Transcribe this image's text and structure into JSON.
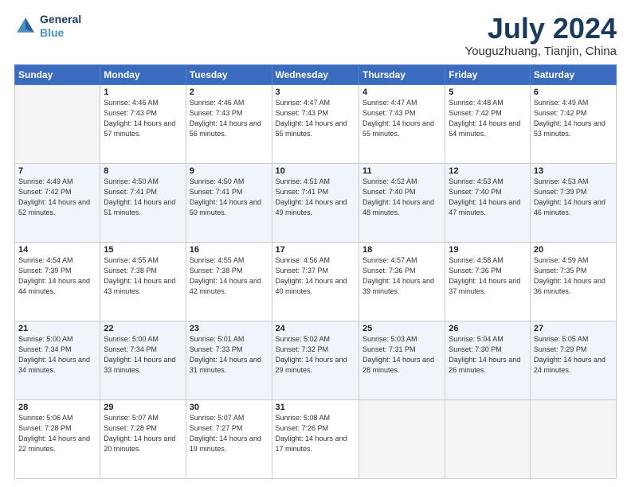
{
  "header": {
    "logo_line1": "General",
    "logo_line2": "Blue",
    "title": "July 2024",
    "subtitle": "Youguzhuang, Tianjin, China"
  },
  "weekdays": [
    "Sunday",
    "Monday",
    "Tuesday",
    "Wednesday",
    "Thursday",
    "Friday",
    "Saturday"
  ],
  "weeks": [
    [
      {
        "day": "",
        "empty": true
      },
      {
        "day": "1",
        "sunrise": "4:46 AM",
        "sunset": "7:43 PM",
        "daylight": "14 hours and 57 minutes."
      },
      {
        "day": "2",
        "sunrise": "4:46 AM",
        "sunset": "7:43 PM",
        "daylight": "14 hours and 56 minutes."
      },
      {
        "day": "3",
        "sunrise": "4:47 AM",
        "sunset": "7:43 PM",
        "daylight": "14 hours and 55 minutes."
      },
      {
        "day": "4",
        "sunrise": "4:47 AM",
        "sunset": "7:43 PM",
        "daylight": "14 hours and 55 minutes."
      },
      {
        "day": "5",
        "sunrise": "4:48 AM",
        "sunset": "7:42 PM",
        "daylight": "14 hours and 54 minutes."
      },
      {
        "day": "6",
        "sunrise": "4:49 AM",
        "sunset": "7:42 PM",
        "daylight": "14 hours and 53 minutes."
      }
    ],
    [
      {
        "day": "7",
        "sunrise": "4:49 AM",
        "sunset": "7:42 PM",
        "daylight": "14 hours and 52 minutes."
      },
      {
        "day": "8",
        "sunrise": "4:50 AM",
        "sunset": "7:41 PM",
        "daylight": "14 hours and 51 minutes."
      },
      {
        "day": "9",
        "sunrise": "4:50 AM",
        "sunset": "7:41 PM",
        "daylight": "14 hours and 50 minutes."
      },
      {
        "day": "10",
        "sunrise": "4:51 AM",
        "sunset": "7:41 PM",
        "daylight": "14 hours and 49 minutes."
      },
      {
        "day": "11",
        "sunrise": "4:52 AM",
        "sunset": "7:40 PM",
        "daylight": "14 hours and 48 minutes."
      },
      {
        "day": "12",
        "sunrise": "4:53 AM",
        "sunset": "7:40 PM",
        "daylight": "14 hours and 47 minutes."
      },
      {
        "day": "13",
        "sunrise": "4:53 AM",
        "sunset": "7:39 PM",
        "daylight": "14 hours and 46 minutes."
      }
    ],
    [
      {
        "day": "14",
        "sunrise": "4:54 AM",
        "sunset": "7:39 PM",
        "daylight": "14 hours and 44 minutes."
      },
      {
        "day": "15",
        "sunrise": "4:55 AM",
        "sunset": "7:38 PM",
        "daylight": "14 hours and 43 minutes."
      },
      {
        "day": "16",
        "sunrise": "4:55 AM",
        "sunset": "7:38 PM",
        "daylight": "14 hours and 42 minutes."
      },
      {
        "day": "17",
        "sunrise": "4:56 AM",
        "sunset": "7:37 PM",
        "daylight": "14 hours and 40 minutes."
      },
      {
        "day": "18",
        "sunrise": "4:57 AM",
        "sunset": "7:36 PM",
        "daylight": "14 hours and 39 minutes."
      },
      {
        "day": "19",
        "sunrise": "4:58 AM",
        "sunset": "7:36 PM",
        "daylight": "14 hours and 37 minutes."
      },
      {
        "day": "20",
        "sunrise": "4:59 AM",
        "sunset": "7:35 PM",
        "daylight": "14 hours and 36 minutes."
      }
    ],
    [
      {
        "day": "21",
        "sunrise": "5:00 AM",
        "sunset": "7:34 PM",
        "daylight": "14 hours and 34 minutes."
      },
      {
        "day": "22",
        "sunrise": "5:00 AM",
        "sunset": "7:34 PM",
        "daylight": "14 hours and 33 minutes."
      },
      {
        "day": "23",
        "sunrise": "5:01 AM",
        "sunset": "7:33 PM",
        "daylight": "14 hours and 31 minutes."
      },
      {
        "day": "24",
        "sunrise": "5:02 AM",
        "sunset": "7:32 PM",
        "daylight": "14 hours and 29 minutes."
      },
      {
        "day": "25",
        "sunrise": "5:03 AM",
        "sunset": "7:31 PM",
        "daylight": "14 hours and 28 minutes."
      },
      {
        "day": "26",
        "sunrise": "5:04 AM",
        "sunset": "7:30 PM",
        "daylight": "14 hours and 26 minutes."
      },
      {
        "day": "27",
        "sunrise": "5:05 AM",
        "sunset": "7:29 PM",
        "daylight": "14 hours and 24 minutes."
      }
    ],
    [
      {
        "day": "28",
        "sunrise": "5:06 AM",
        "sunset": "7:28 PM",
        "daylight": "14 hours and 22 minutes."
      },
      {
        "day": "29",
        "sunrise": "5:07 AM",
        "sunset": "7:28 PM",
        "daylight": "14 hours and 20 minutes."
      },
      {
        "day": "30",
        "sunrise": "5:07 AM",
        "sunset": "7:27 PM",
        "daylight": "14 hours and 19 minutes."
      },
      {
        "day": "31",
        "sunrise": "5:08 AM",
        "sunset": "7:26 PM",
        "daylight": "14 hours and 17 minutes."
      },
      {
        "day": "",
        "empty": true
      },
      {
        "day": "",
        "empty": true
      },
      {
        "day": "",
        "empty": true
      }
    ]
  ]
}
